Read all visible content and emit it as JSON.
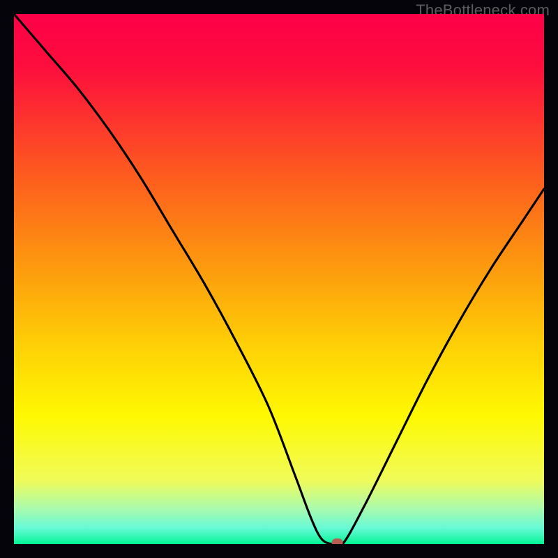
{
  "watermark": "TheBottleneck.com",
  "colors": {
    "top": "#fd0047",
    "red": "#fd0e3d",
    "orange_red": "#fd5a1f",
    "orange": "#fd9b0e",
    "yellow_orange": "#fece06",
    "yellow": "#fef902",
    "pale_yellow": "#f0fb5b",
    "pale_green": "#aefba8",
    "light_green": "#67f9d7",
    "green": "#04f696",
    "curve": "#000000",
    "marker": "#b55e52",
    "background": "#000000"
  },
  "chart_data": {
    "type": "line",
    "title": "",
    "xlabel": "",
    "ylabel": "",
    "xlim": [
      0,
      100
    ],
    "ylim": [
      0,
      100
    ],
    "grid": false,
    "legend": false,
    "series": [
      {
        "name": "curve",
        "x": [
          0,
          6,
          12,
          18,
          24,
          30,
          36,
          42,
          48,
          53,
          56,
          58,
          60,
          62,
          66,
          72,
          78,
          84,
          90,
          96,
          100
        ],
        "y": [
          100,
          93,
          86,
          78,
          69,
          59,
          49,
          38,
          26,
          13,
          5,
          1,
          0,
          0,
          7,
          19,
          31,
          42,
          52,
          61,
          67
        ]
      }
    ],
    "marker": {
      "x": 61,
      "y": 0
    }
  }
}
